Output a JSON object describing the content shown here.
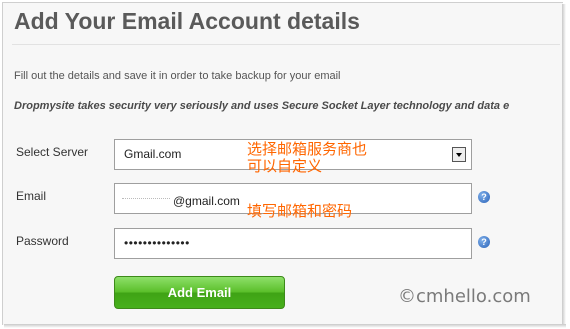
{
  "page": {
    "title": "Add Your Email Account details",
    "description": "Fill out the details and save it in order to take backup for your email",
    "notice": "Dropmysite takes security very seriously and uses Secure Socket Layer technology and data e"
  },
  "form": {
    "server_label": "Select Server",
    "server_value": "Gmail.com",
    "email_label": "Email",
    "email_value": "@gmail.com",
    "password_label": "Password",
    "password_value": "••••••••••••••",
    "help_glyph": "?",
    "submit_label": "Add Email"
  },
  "annotations": {
    "server_note_line1": "选择邮箱服务商也",
    "server_note_line2": "可以自定义",
    "fields_note": "填写邮箱和密码"
  },
  "watermark": "©cmhello.com",
  "colors": {
    "annotation": "#ff6600",
    "button_green": "#4fb522",
    "help_blue": "#2a62b8"
  }
}
